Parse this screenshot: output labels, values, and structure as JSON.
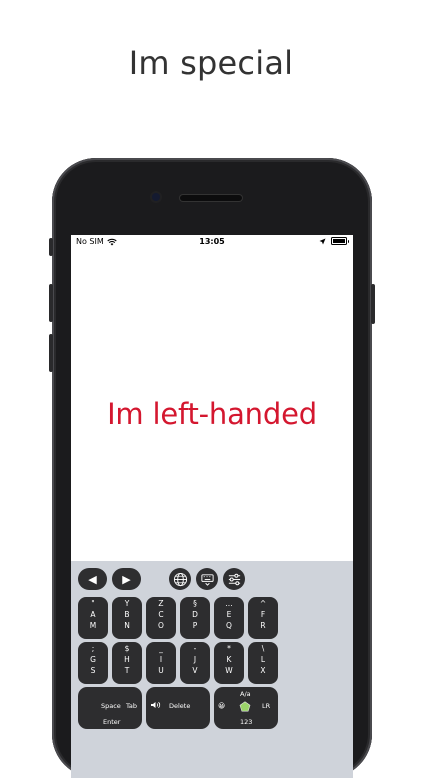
{
  "headline": "Im special",
  "status": {
    "carrier": "No SIM",
    "time": "13:05"
  },
  "main_text": "Im left-handed",
  "keyboard": {
    "row1": [
      {
        "t": "\"",
        "m": "A",
        "b": "M"
      },
      {
        "t": "Y",
        "m": "B",
        "b": "N"
      },
      {
        "t": "Z",
        "m": "C",
        "b": "O"
      },
      {
        "t": "§",
        "m": "D",
        "b": "P"
      },
      {
        "t": "...",
        "m": "E",
        "b": "Q"
      },
      {
        "t": "^",
        "m": "F",
        "b": "R"
      }
    ],
    "row2": [
      {
        "t": ";",
        "m": "G",
        "b": "S"
      },
      {
        "t": "$",
        "m": "H",
        "b": "T"
      },
      {
        "t": "_",
        "m": "I",
        "b": "U"
      },
      {
        "t": "-",
        "m": "J",
        "b": "V"
      },
      {
        "t": "*",
        "m": "K",
        "b": "W"
      },
      {
        "t": "\\",
        "m": "L",
        "b": "X"
      }
    ],
    "space_label": "Space",
    "tab_label": "Tab",
    "enter_label": "Enter",
    "delete_label": "Delete",
    "case_label": "A/a",
    "lr_label": "LR",
    "numbers_label": "123",
    "emoji": "😀",
    "left_arrow": "◀",
    "right_arrow": "▶"
  }
}
